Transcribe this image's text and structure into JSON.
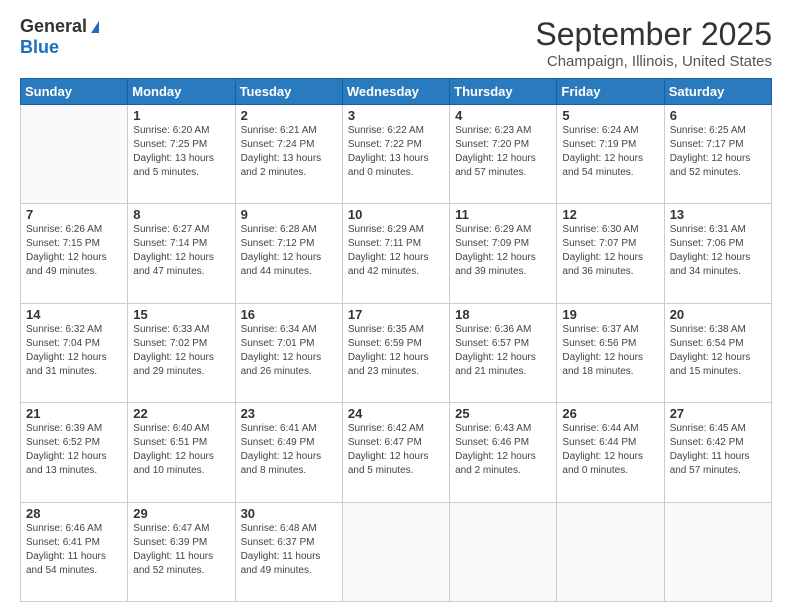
{
  "logo": {
    "general": "General",
    "blue": "Blue"
  },
  "header": {
    "month": "September 2025",
    "location": "Champaign, Illinois, United States"
  },
  "weekdays": [
    "Sunday",
    "Monday",
    "Tuesday",
    "Wednesday",
    "Thursday",
    "Friday",
    "Saturday"
  ],
  "weeks": [
    [
      {
        "day": "",
        "empty": true
      },
      {
        "day": "1",
        "sunrise": "Sunrise: 6:20 AM",
        "sunset": "Sunset: 7:25 PM",
        "daylight": "Daylight: 13 hours and 5 minutes."
      },
      {
        "day": "2",
        "sunrise": "Sunrise: 6:21 AM",
        "sunset": "Sunset: 7:24 PM",
        "daylight": "Daylight: 13 hours and 2 minutes."
      },
      {
        "day": "3",
        "sunrise": "Sunrise: 6:22 AM",
        "sunset": "Sunset: 7:22 PM",
        "daylight": "Daylight: 13 hours and 0 minutes."
      },
      {
        "day": "4",
        "sunrise": "Sunrise: 6:23 AM",
        "sunset": "Sunset: 7:20 PM",
        "daylight": "Daylight: 12 hours and 57 minutes."
      },
      {
        "day": "5",
        "sunrise": "Sunrise: 6:24 AM",
        "sunset": "Sunset: 7:19 PM",
        "daylight": "Daylight: 12 hours and 54 minutes."
      },
      {
        "day": "6",
        "sunrise": "Sunrise: 6:25 AM",
        "sunset": "Sunset: 7:17 PM",
        "daylight": "Daylight: 12 hours and 52 minutes."
      }
    ],
    [
      {
        "day": "7",
        "sunrise": "Sunrise: 6:26 AM",
        "sunset": "Sunset: 7:15 PM",
        "daylight": "Daylight: 12 hours and 49 minutes."
      },
      {
        "day": "8",
        "sunrise": "Sunrise: 6:27 AM",
        "sunset": "Sunset: 7:14 PM",
        "daylight": "Daylight: 12 hours and 47 minutes."
      },
      {
        "day": "9",
        "sunrise": "Sunrise: 6:28 AM",
        "sunset": "Sunset: 7:12 PM",
        "daylight": "Daylight: 12 hours and 44 minutes."
      },
      {
        "day": "10",
        "sunrise": "Sunrise: 6:29 AM",
        "sunset": "Sunset: 7:11 PM",
        "daylight": "Daylight: 12 hours and 42 minutes."
      },
      {
        "day": "11",
        "sunrise": "Sunrise: 6:29 AM",
        "sunset": "Sunset: 7:09 PM",
        "daylight": "Daylight: 12 hours and 39 minutes."
      },
      {
        "day": "12",
        "sunrise": "Sunrise: 6:30 AM",
        "sunset": "Sunset: 7:07 PM",
        "daylight": "Daylight: 12 hours and 36 minutes."
      },
      {
        "day": "13",
        "sunrise": "Sunrise: 6:31 AM",
        "sunset": "Sunset: 7:06 PM",
        "daylight": "Daylight: 12 hours and 34 minutes."
      }
    ],
    [
      {
        "day": "14",
        "sunrise": "Sunrise: 6:32 AM",
        "sunset": "Sunset: 7:04 PM",
        "daylight": "Daylight: 12 hours and 31 minutes."
      },
      {
        "day": "15",
        "sunrise": "Sunrise: 6:33 AM",
        "sunset": "Sunset: 7:02 PM",
        "daylight": "Daylight: 12 hours and 29 minutes."
      },
      {
        "day": "16",
        "sunrise": "Sunrise: 6:34 AM",
        "sunset": "Sunset: 7:01 PM",
        "daylight": "Daylight: 12 hours and 26 minutes."
      },
      {
        "day": "17",
        "sunrise": "Sunrise: 6:35 AM",
        "sunset": "Sunset: 6:59 PM",
        "daylight": "Daylight: 12 hours and 23 minutes."
      },
      {
        "day": "18",
        "sunrise": "Sunrise: 6:36 AM",
        "sunset": "Sunset: 6:57 PM",
        "daylight": "Daylight: 12 hours and 21 minutes."
      },
      {
        "day": "19",
        "sunrise": "Sunrise: 6:37 AM",
        "sunset": "Sunset: 6:56 PM",
        "daylight": "Daylight: 12 hours and 18 minutes."
      },
      {
        "day": "20",
        "sunrise": "Sunrise: 6:38 AM",
        "sunset": "Sunset: 6:54 PM",
        "daylight": "Daylight: 12 hours and 15 minutes."
      }
    ],
    [
      {
        "day": "21",
        "sunrise": "Sunrise: 6:39 AM",
        "sunset": "Sunset: 6:52 PM",
        "daylight": "Daylight: 12 hours and 13 minutes."
      },
      {
        "day": "22",
        "sunrise": "Sunrise: 6:40 AM",
        "sunset": "Sunset: 6:51 PM",
        "daylight": "Daylight: 12 hours and 10 minutes."
      },
      {
        "day": "23",
        "sunrise": "Sunrise: 6:41 AM",
        "sunset": "Sunset: 6:49 PM",
        "daylight": "Daylight: 12 hours and 8 minutes."
      },
      {
        "day": "24",
        "sunrise": "Sunrise: 6:42 AM",
        "sunset": "Sunset: 6:47 PM",
        "daylight": "Daylight: 12 hours and 5 minutes."
      },
      {
        "day": "25",
        "sunrise": "Sunrise: 6:43 AM",
        "sunset": "Sunset: 6:46 PM",
        "daylight": "Daylight: 12 hours and 2 minutes."
      },
      {
        "day": "26",
        "sunrise": "Sunrise: 6:44 AM",
        "sunset": "Sunset: 6:44 PM",
        "daylight": "Daylight: 12 hours and 0 minutes."
      },
      {
        "day": "27",
        "sunrise": "Sunrise: 6:45 AM",
        "sunset": "Sunset: 6:42 PM",
        "daylight": "Daylight: 11 hours and 57 minutes."
      }
    ],
    [
      {
        "day": "28",
        "sunrise": "Sunrise: 6:46 AM",
        "sunset": "Sunset: 6:41 PM",
        "daylight": "Daylight: 11 hours and 54 minutes."
      },
      {
        "day": "29",
        "sunrise": "Sunrise: 6:47 AM",
        "sunset": "Sunset: 6:39 PM",
        "daylight": "Daylight: 11 hours and 52 minutes."
      },
      {
        "day": "30",
        "sunrise": "Sunrise: 6:48 AM",
        "sunset": "Sunset: 6:37 PM",
        "daylight": "Daylight: 11 hours and 49 minutes."
      },
      {
        "day": "",
        "empty": true
      },
      {
        "day": "",
        "empty": true
      },
      {
        "day": "",
        "empty": true
      },
      {
        "day": "",
        "empty": true
      }
    ]
  ]
}
